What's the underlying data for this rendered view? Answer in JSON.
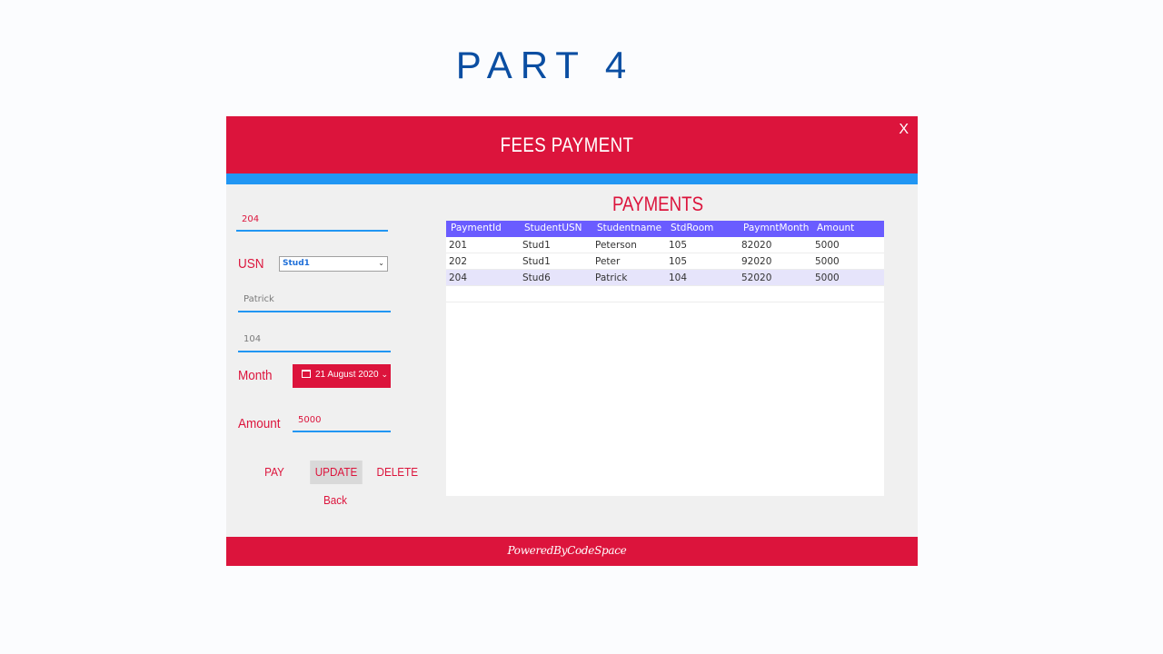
{
  "slide": {
    "title": "PART 4"
  },
  "window": {
    "title": "FEES PAYMENT",
    "close_label": "X",
    "footer": "PoweredByCodeSpace"
  },
  "form": {
    "payment_id": "204",
    "usn_label": "USN",
    "usn_selected": "Stud1",
    "student_name": "Patrick",
    "room": "104",
    "month_label": "Month",
    "month_value": "21 August 2020",
    "amount_label": "Amount",
    "amount_value": "5000"
  },
  "buttons": {
    "pay": "PAY",
    "update": "UPDATE",
    "delete": "DELETE",
    "back": "Back"
  },
  "payments": {
    "title": "PAYMENTS",
    "columns": [
      "PaymentId",
      "StudentUSN",
      "Studentname",
      "StdRoom",
      "PaymntMonth",
      "Amount"
    ],
    "rows": [
      [
        "201",
        "Stud1",
        "Peterson",
        "105",
        "82020",
        "5000"
      ],
      [
        "202",
        "Stud1",
        "Peter",
        "105",
        "92020",
        "5000"
      ],
      [
        "204",
        "Stud6",
        "Patrick",
        "104",
        "52020",
        "5000"
      ]
    ],
    "selected_row": 2
  },
  "colors": {
    "accent": "#dc143c",
    "strip": "#2196f3",
    "grid_header": "#6a5cff",
    "slide_title": "#0b4ea2"
  }
}
